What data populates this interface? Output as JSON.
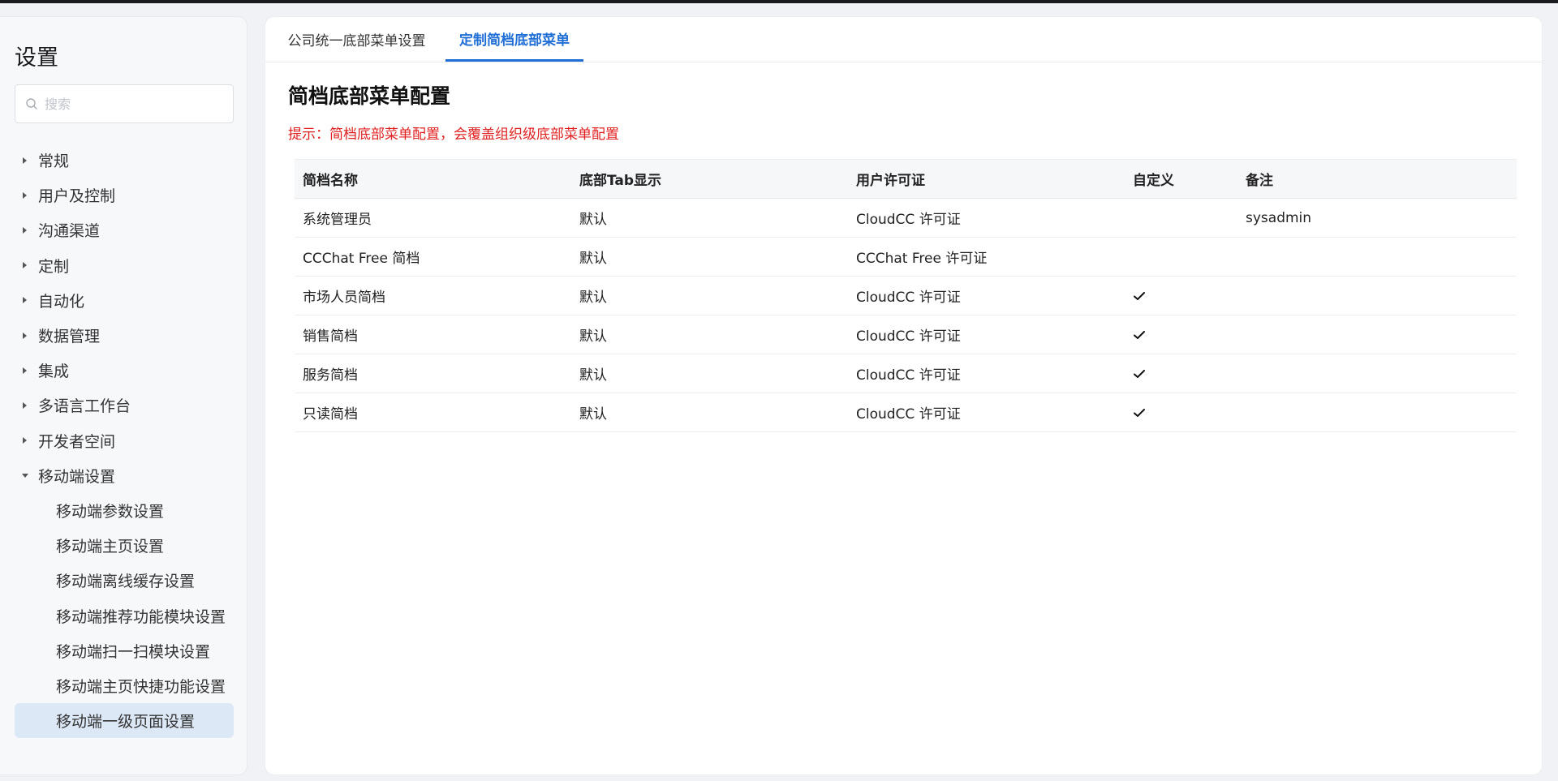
{
  "sidebar": {
    "title": "设置",
    "search_placeholder": "搜索",
    "items": [
      {
        "label": "常规"
      },
      {
        "label": "用户及控制"
      },
      {
        "label": "沟通渠道"
      },
      {
        "label": "定制"
      },
      {
        "label": "自动化"
      },
      {
        "label": "数据管理"
      },
      {
        "label": "集成"
      },
      {
        "label": "多语言工作台"
      },
      {
        "label": "开发者空间"
      },
      {
        "label": "移动端设置"
      }
    ],
    "sub_items": [
      {
        "label": "移动端参数设置"
      },
      {
        "label": "移动端主页设置"
      },
      {
        "label": "移动端离线缓存设置"
      },
      {
        "label": "移动端推荐功能模块设置"
      },
      {
        "label": "移动端扫一扫模块设置"
      },
      {
        "label": "移动端主页快捷功能设置"
      },
      {
        "label": "移动端一级页面设置"
      }
    ]
  },
  "tabs": [
    {
      "label": "公司统一底部菜单设置"
    },
    {
      "label": "定制简档底部菜单"
    }
  ],
  "main": {
    "title": "简档底部菜单配置",
    "hint": "提示：简档底部菜单配置，会覆盖组织级底部菜单配置"
  },
  "table": {
    "headers": [
      "简档名称",
      "底部Tab显示",
      "用户许可证",
      "自定义",
      "备注"
    ],
    "rows": [
      {
        "name": "系统管理员",
        "tab": "默认",
        "license": "CloudCC 许可证",
        "custom": false,
        "note": "sysadmin"
      },
      {
        "name": "CCChat Free 简档",
        "tab": "默认",
        "license": "CCChat Free 许可证",
        "custom": false,
        "note": ""
      },
      {
        "name": "市场人员简档",
        "tab": "默认",
        "license": "CloudCC 许可证",
        "custom": true,
        "note": ""
      },
      {
        "name": "销售简档",
        "tab": "默认",
        "license": "CloudCC 许可证",
        "custom": true,
        "note": ""
      },
      {
        "name": "服务简档",
        "tab": "默认",
        "license": "CloudCC 许可证",
        "custom": true,
        "note": ""
      },
      {
        "name": "只读简档",
        "tab": "默认",
        "license": "CloudCC 许可证",
        "custom": true,
        "note": ""
      }
    ]
  },
  "colors": {
    "accent": "#1f6fd6",
    "hint": "#e02020",
    "active_bg": "#dde8f7"
  }
}
